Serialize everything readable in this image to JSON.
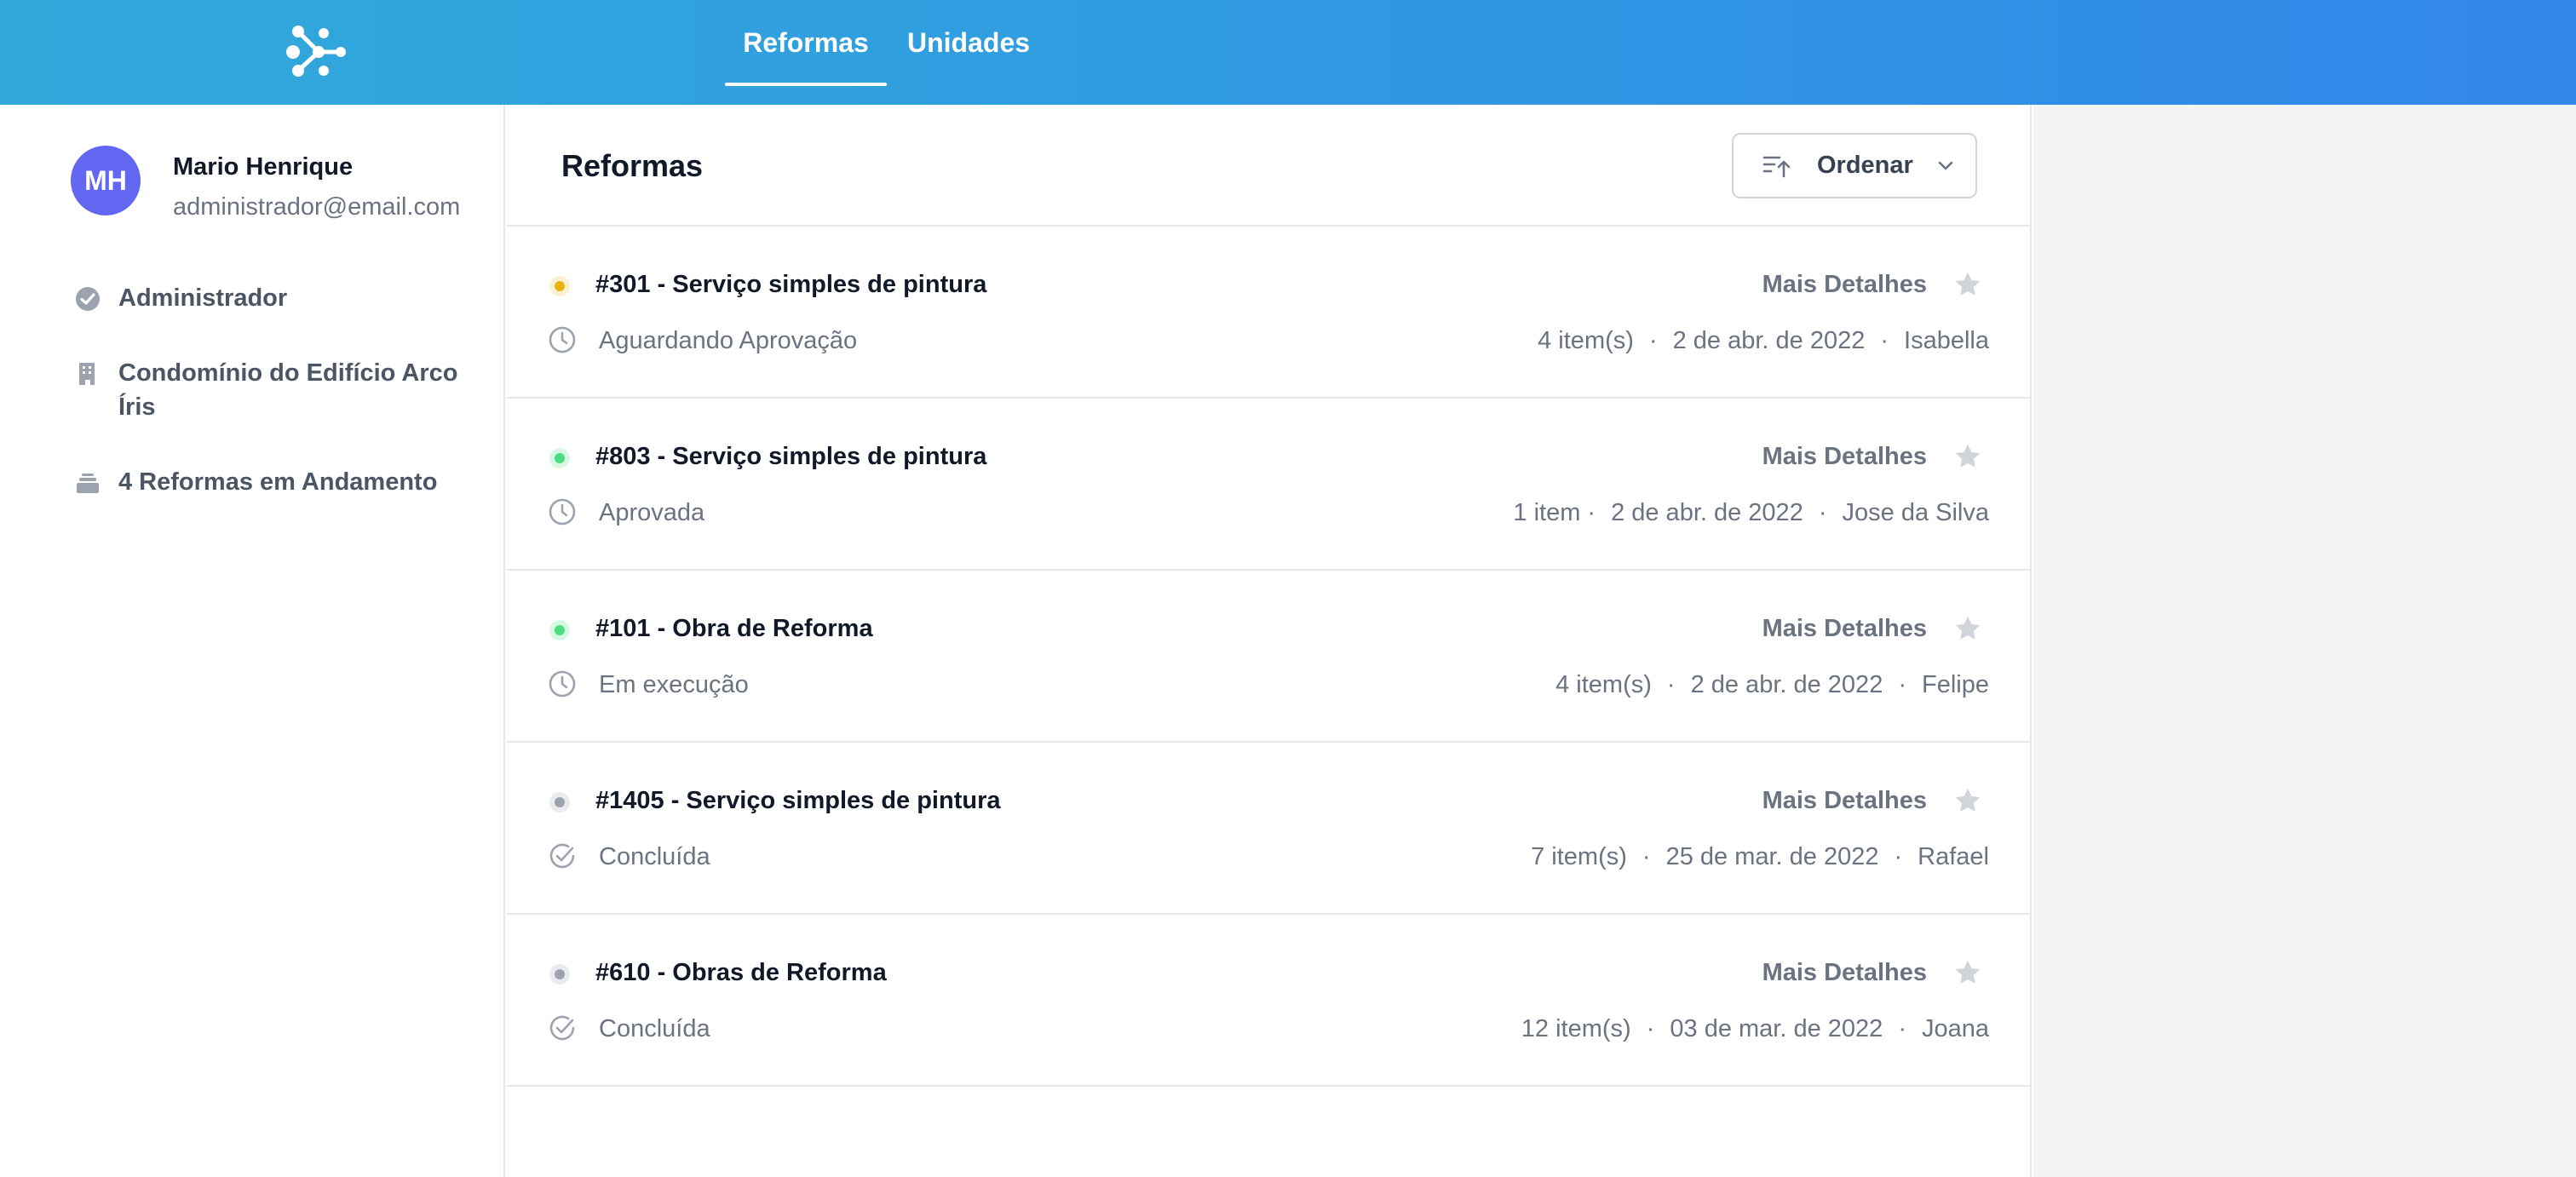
{
  "header": {
    "logo_icon": "app-logo-icon",
    "tabs": [
      {
        "label": "Reformas",
        "active": true
      },
      {
        "label": "Unidades",
        "active": false
      }
    ],
    "gradient_start": "#31aadb",
    "gradient_end": "#3287ea"
  },
  "user": {
    "initials": "MH",
    "name": "Mario Henrique",
    "email": "administrador@email.com",
    "avatar_color": "#6366f1"
  },
  "sidebar": {
    "items": [
      {
        "icon": "check-badge-icon",
        "label": "Administrador"
      },
      {
        "icon": "building-icon",
        "label": "Condomínio do Edifício Arco Íris"
      },
      {
        "icon": "stack-icon",
        "label": "4 Reformas em Andamento"
      }
    ]
  },
  "main": {
    "title": "Reformas",
    "sort_label": "Ordenar",
    "rows": [
      {
        "title": "#301 - Serviço simples de pintura",
        "status": "Aguardando Aprovação",
        "status_icon": "clock-icon",
        "dot_color": "#eab308",
        "items": "4 item(s)",
        "date": "2 de abr. de 2022",
        "person": "Isabella",
        "details_label": "Mais Detalhes"
      },
      {
        "title": "#803 - Serviço simples de pintura",
        "status": "Aprovada",
        "status_icon": "clock-icon",
        "dot_color": "#4ade80",
        "items": "1 item",
        "date": "2 de abr. de 2022",
        "person": "Jose da Silva",
        "details_label": "Mais Detalhes"
      },
      {
        "title": "#101 - Obra de Reforma",
        "status": "Em execução",
        "status_icon": "clock-icon",
        "dot_color": "#4ade80",
        "items": "4 item(s)",
        "date": "2 de abr. de 2022",
        "person": "Felipe",
        "details_label": "Mais Detalhes"
      },
      {
        "title": "#1405 - Serviço simples de pintura",
        "status": "Concluída",
        "status_icon": "check-circle-icon",
        "dot_color": "#9ca3af",
        "items": "7 item(s)",
        "date": "25 de mar. de 2022",
        "person": "Rafael",
        "details_label": "Mais Detalhes"
      },
      {
        "title": "#610 - Obras de Reforma",
        "status": "Concluída",
        "status_icon": "check-circle-icon",
        "dot_color": "#9ca3af",
        "items": "12 item(s)",
        "date": "03 de mar. de 2022",
        "person": "Joana",
        "details_label": "Mais Detalhes"
      }
    ]
  }
}
